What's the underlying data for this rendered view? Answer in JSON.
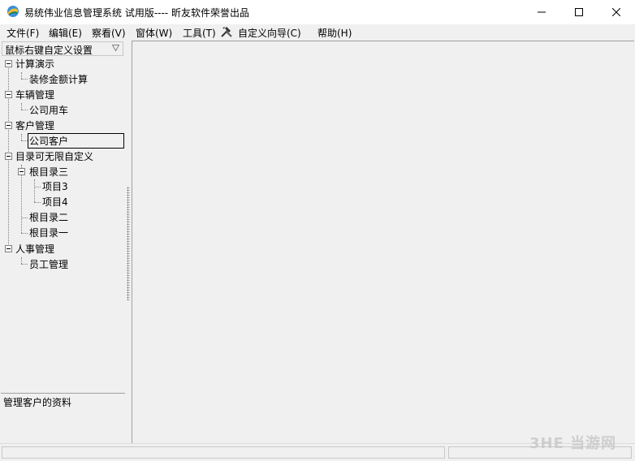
{
  "window": {
    "title": "易统伟业信息管理系统 试用版---- 昕友软件荣誉出品",
    "minimize_icon": "minimize-icon",
    "maximize_icon": "maximize-icon",
    "close_icon": "close-icon"
  },
  "menu": {
    "items": [
      {
        "label": "文件(F)"
      },
      {
        "label": "编辑(E)"
      },
      {
        "label": "察看(V)"
      },
      {
        "label": "窗体(W)"
      },
      {
        "label": "工具(T)"
      },
      {
        "label": "自定义向导(C)",
        "icon": "tools-icon"
      },
      {
        "label": "帮助(H)"
      }
    ]
  },
  "left_panel": {
    "combo_label": "鼠标右键自定义设置",
    "tree": [
      {
        "label": "计算演示"
      },
      {
        "label": "装修金额计算"
      },
      {
        "label": "车辆管理"
      },
      {
        "label": "公司用车"
      },
      {
        "label": "客户管理"
      },
      {
        "label": "公司客户"
      },
      {
        "label": "目录可无限自定义"
      },
      {
        "label": "根目录三"
      },
      {
        "label": "项目3"
      },
      {
        "label": "项目4"
      },
      {
        "label": "根目录二"
      },
      {
        "label": "根目录一"
      },
      {
        "label": "人事管理"
      },
      {
        "label": "员工管理"
      }
    ],
    "hint": "管理客户的资料"
  },
  "watermark": "3HE 当游网",
  "colors": {
    "window_bg": "#f0f0f0",
    "titlebar_bg": "#ffffff",
    "tree_line": "#808080"
  }
}
